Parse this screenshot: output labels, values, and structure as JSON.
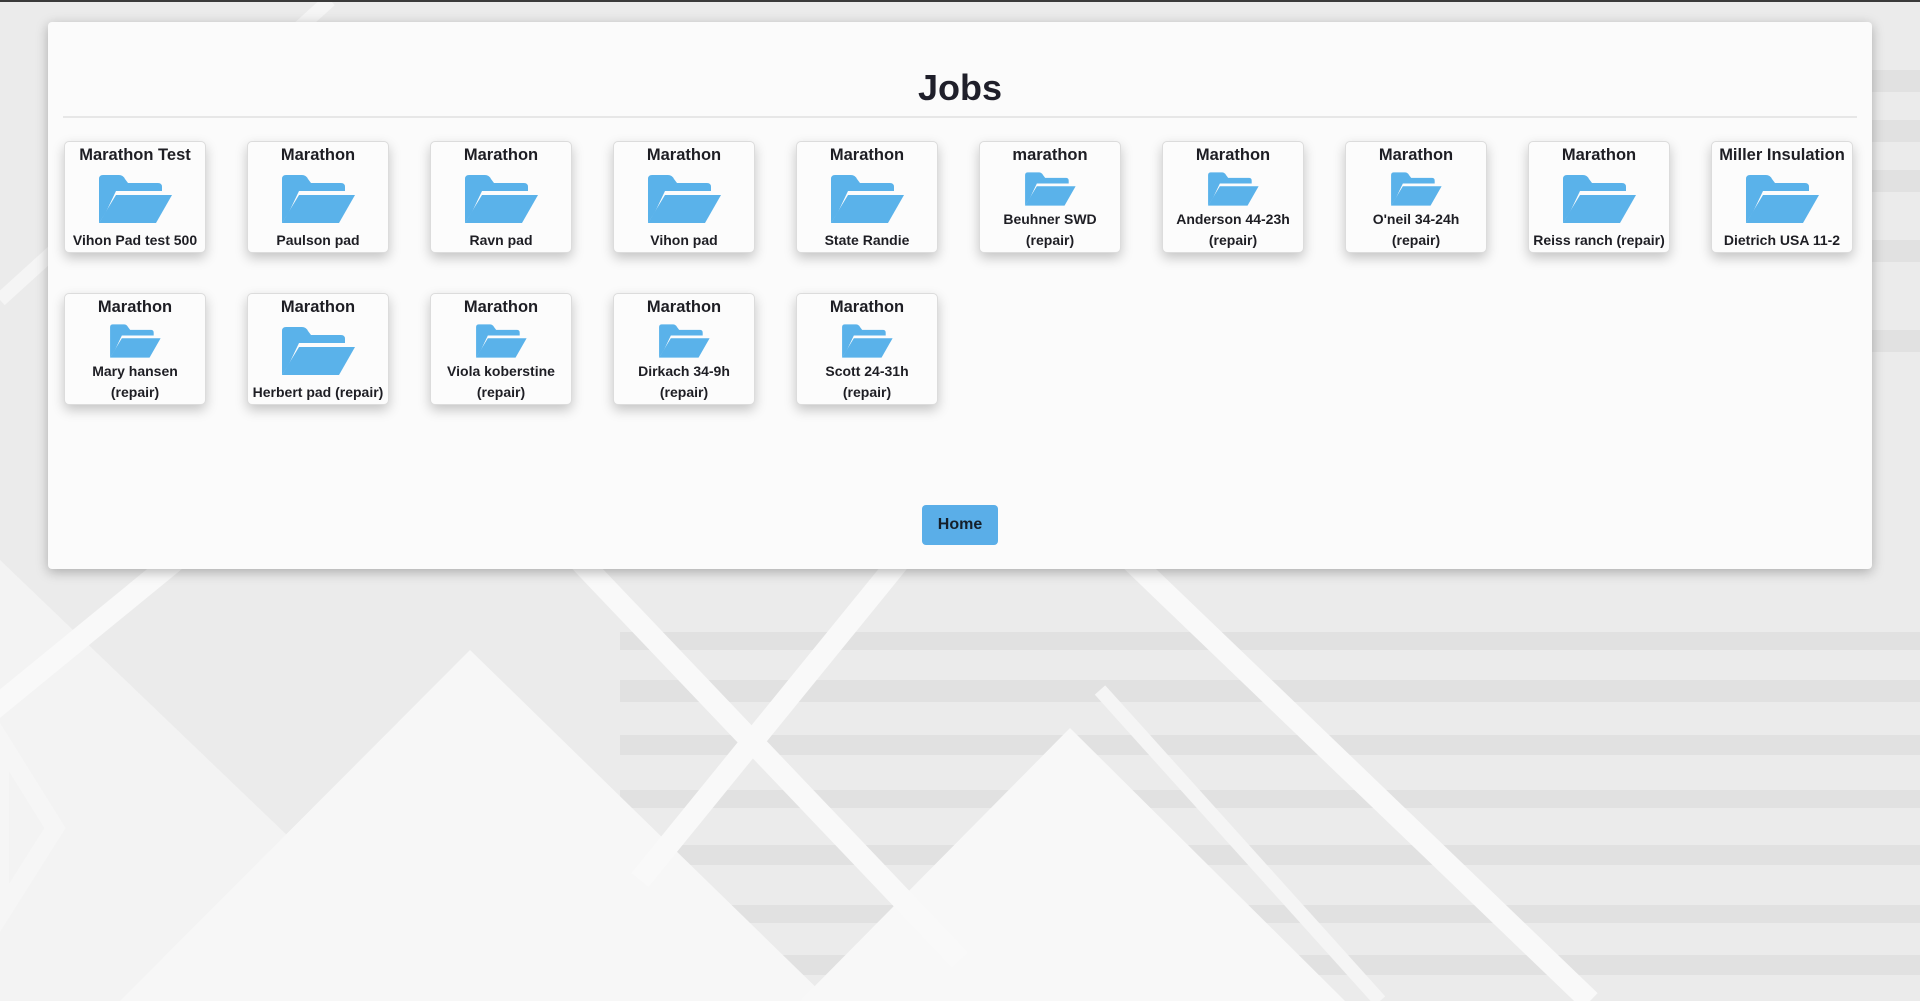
{
  "page": {
    "title": "Jobs"
  },
  "colors": {
    "accent": "#5aaee8",
    "folder": "#5ab2ea"
  },
  "jobs": [
    {
      "company": "Marathon Test",
      "name": "Vihon Pad test 500",
      "icon": "folder-open-icon"
    },
    {
      "company": "Marathon",
      "name": "Paulson pad",
      "icon": "folder-open-icon"
    },
    {
      "company": "Marathon",
      "name": "Ravn pad",
      "icon": "folder-open-icon"
    },
    {
      "company": "Marathon",
      "name": "Vihon pad",
      "icon": "folder-open-icon"
    },
    {
      "company": "Marathon",
      "name": "State Randie",
      "icon": "folder-open-icon"
    },
    {
      "company": "marathon",
      "name": "Beuhner SWD (repair)",
      "icon": "folder-open-icon"
    },
    {
      "company": "Marathon",
      "name": "Anderson 44-23h (repair)",
      "icon": "folder-open-icon"
    },
    {
      "company": "Marathon",
      "name": "O'neil 34-24h (repair)",
      "icon": "folder-open-icon"
    },
    {
      "company": "Marathon",
      "name": "Reiss ranch (repair)",
      "icon": "folder-open-icon"
    },
    {
      "company": "Miller Insulation",
      "name": "Dietrich USA 11-2",
      "icon": "folder-open-icon"
    },
    {
      "company": "Marathon",
      "name": "Mary hansen (repair)",
      "icon": "folder-open-icon"
    },
    {
      "company": "Marathon",
      "name": "Herbert pad (repair)",
      "icon": "folder-open-icon"
    },
    {
      "company": "Marathon",
      "name": "Viola koberstine (repair)",
      "icon": "folder-open-icon"
    },
    {
      "company": "Marathon",
      "name": "Dirkach 34-9h (repair)",
      "icon": "folder-open-icon"
    },
    {
      "company": "Marathon",
      "name": "Scott 24-31h (repair)",
      "icon": "folder-open-icon"
    }
  ],
  "footer": {
    "home_label": "Home"
  }
}
